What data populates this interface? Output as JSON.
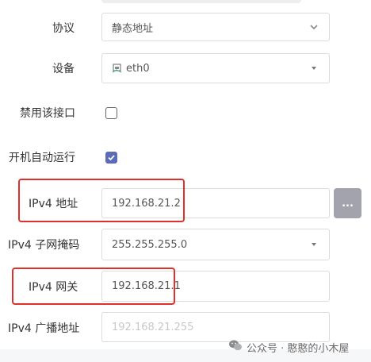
{
  "form": {
    "protocol": {
      "label": "协议",
      "value": "静态地址"
    },
    "device": {
      "label": "设备",
      "value": "eth0"
    },
    "disable_interface": {
      "label": "禁用该接口",
      "checked": false
    },
    "auto_start": {
      "label": "开机自动运行",
      "checked": true
    },
    "ipv4_address": {
      "label": "IPv4 地址",
      "value": "192.168.21.2",
      "more_button": "..."
    },
    "ipv4_netmask": {
      "label": "IPv4 子网掩码",
      "value": "255.255.255.0"
    },
    "ipv4_gateway": {
      "label": "IPv4 网关",
      "value": "192.168.21.1"
    },
    "ipv4_broadcast": {
      "label": "IPv4 广播地址",
      "placeholder": "192.168.21.255"
    }
  },
  "watermark": {
    "text": "公众号 · 憨憨的小木屋",
    "icon": "wechat-icon"
  },
  "colors": {
    "accent": "#5b6bb8",
    "highlight": "#e0302a",
    "button": "#a3a3ad"
  }
}
